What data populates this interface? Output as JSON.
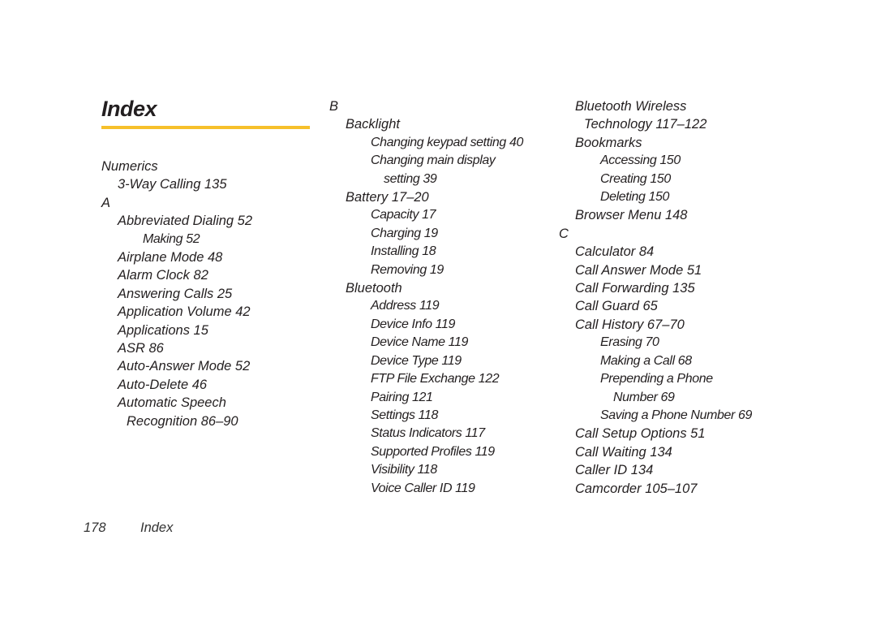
{
  "page": {
    "title": "Index",
    "accent_color": "#f6c02b"
  },
  "columns": [
    {
      "entries": [
        {
          "level": "letter",
          "text": "Numerics"
        },
        {
          "level": "l1",
          "text": "3-Way Calling 135"
        },
        {
          "level": "letter",
          "text": "A"
        },
        {
          "level": "l1",
          "text": "Abbreviated Dialing 52"
        },
        {
          "level": "l2",
          "text": "Making 52"
        },
        {
          "level": "l1",
          "text": "Airplane Mode 48"
        },
        {
          "level": "l1",
          "text": "Alarm Clock 82"
        },
        {
          "level": "l1",
          "text": "Answering Calls 25"
        },
        {
          "level": "l1",
          "text": "Application Volume 42"
        },
        {
          "level": "l1",
          "text": "Applications 15"
        },
        {
          "level": "l1",
          "text": "ASR 86"
        },
        {
          "level": "l1",
          "text": "Auto-Answer Mode 52"
        },
        {
          "level": "l1",
          "text": "Auto-Delete 46"
        },
        {
          "level": "l1",
          "text": "Automatic Speech"
        },
        {
          "level": "l1c",
          "text": "Recognition 86–90"
        }
      ]
    },
    {
      "entries": [
        {
          "level": "letter",
          "text": "B"
        },
        {
          "level": "l1",
          "text": "Backlight"
        },
        {
          "level": "l2",
          "text": "Changing keypad setting 40"
        },
        {
          "level": "l2",
          "text": "Changing main display"
        },
        {
          "level": "l2c",
          "text": "setting 39"
        },
        {
          "level": "l1",
          "text": "Battery 17–20"
        },
        {
          "level": "l2",
          "text": "Capacity 17"
        },
        {
          "level": "l2",
          "text": "Charging 19"
        },
        {
          "level": "l2",
          "text": "Installing 18"
        },
        {
          "level": "l2",
          "text": "Removing 19"
        },
        {
          "level": "l1",
          "text": "Bluetooth"
        },
        {
          "level": "l2",
          "text": "Address 119"
        },
        {
          "level": "l2",
          "text": "Device Info 119"
        },
        {
          "level": "l2",
          "text": "Device Name 119"
        },
        {
          "level": "l2",
          "text": "Device Type 119"
        },
        {
          "level": "l2",
          "text": "FTP File Exchange 122"
        },
        {
          "level": "l2",
          "text": "Pairing 121"
        },
        {
          "level": "l2",
          "text": "Settings 118"
        },
        {
          "level": "l2",
          "text": "Status Indicators 117"
        },
        {
          "level": "l2",
          "text": "Supported Profiles 119"
        },
        {
          "level": "l2",
          "text": "Visibility 118"
        },
        {
          "level": "l2",
          "text": "Voice Caller ID 119"
        }
      ]
    },
    {
      "entries": [
        {
          "level": "l1",
          "text": "Bluetooth Wireless"
        },
        {
          "level": "l1c",
          "text": "Technology 117–122"
        },
        {
          "level": "l1",
          "text": "Bookmarks"
        },
        {
          "level": "l2",
          "text": "Accessing 150"
        },
        {
          "level": "l2",
          "text": "Creating 150"
        },
        {
          "level": "l2",
          "text": "Deleting 150"
        },
        {
          "level": "l1",
          "text": "Browser Menu 148"
        },
        {
          "level": "letter",
          "text": "C"
        },
        {
          "level": "l1",
          "text": "Calculator 84"
        },
        {
          "level": "l1",
          "text": "Call Answer Mode 51"
        },
        {
          "level": "l1",
          "text": "Call Forwarding 135"
        },
        {
          "level": "l1",
          "text": "Call Guard 65"
        },
        {
          "level": "l1",
          "text": "Call History 67–70"
        },
        {
          "level": "l2",
          "text": "Erasing 70"
        },
        {
          "level": "l2",
          "text": "Making a Call 68"
        },
        {
          "level": "l2",
          "text": "Prepending a Phone"
        },
        {
          "level": "l2c",
          "text": "Number 69"
        },
        {
          "level": "l2",
          "text": "Saving a Phone Number 69"
        },
        {
          "level": "l1",
          "text": "Call Setup Options 51"
        },
        {
          "level": "l1",
          "text": "Call Waiting 134"
        },
        {
          "level": "l1",
          "text": "Caller ID 134"
        },
        {
          "level": "l1",
          "text": "Camcorder 105–107"
        }
      ]
    }
  ],
  "footer": {
    "page_number": "178",
    "section": "Index"
  }
}
